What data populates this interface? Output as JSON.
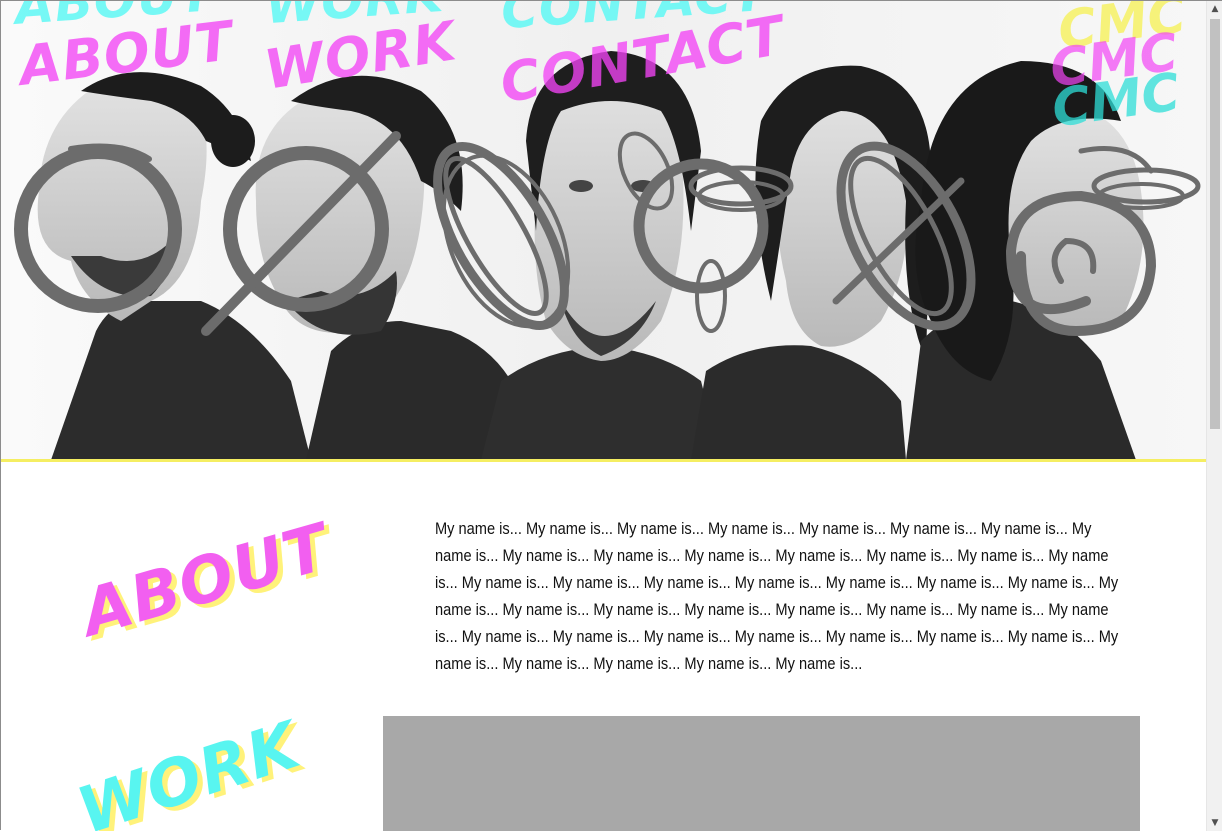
{
  "nav": {
    "about": "ABOUT",
    "work": "WORK",
    "contact": "CONTACT"
  },
  "logo": "CMC",
  "hero": {
    "photo_description_icon": "five-profile-portraits-photo",
    "scribble_icons": [
      "circle-scribble-icon",
      "slashed-circle-scribble-icon",
      "oval-scribble-icon",
      "loop-scribble-icon",
      "cross-scribble-icon",
      "spiral-scribble-icon"
    ]
  },
  "sections": {
    "about": {
      "heading": "ABOUT",
      "text": "My name is... My name is... My name is... My name is... My name is... My name is... My name is... My name is... My name is... My name is... My name is... My name is... My name is... My name is... My name is... My name is... My name is... My name is... My name is... My name is... My name is... My name is... My name is... My name is... My name is... My name is... My name is... My name is... My name is... My name is... My name is... My name is... My name is... My name is... My name is... My name is... My name is... My name is... My name is... My name is... My name is... My name is..."
    },
    "work": {
      "heading": "WORK"
    }
  },
  "colors": {
    "magenta": "#f25ff0",
    "cyan": "#58f5f0",
    "yellow": "#fff27a",
    "scribble": "#6e6e6e",
    "work_placeholder": "#a8a8a8"
  }
}
